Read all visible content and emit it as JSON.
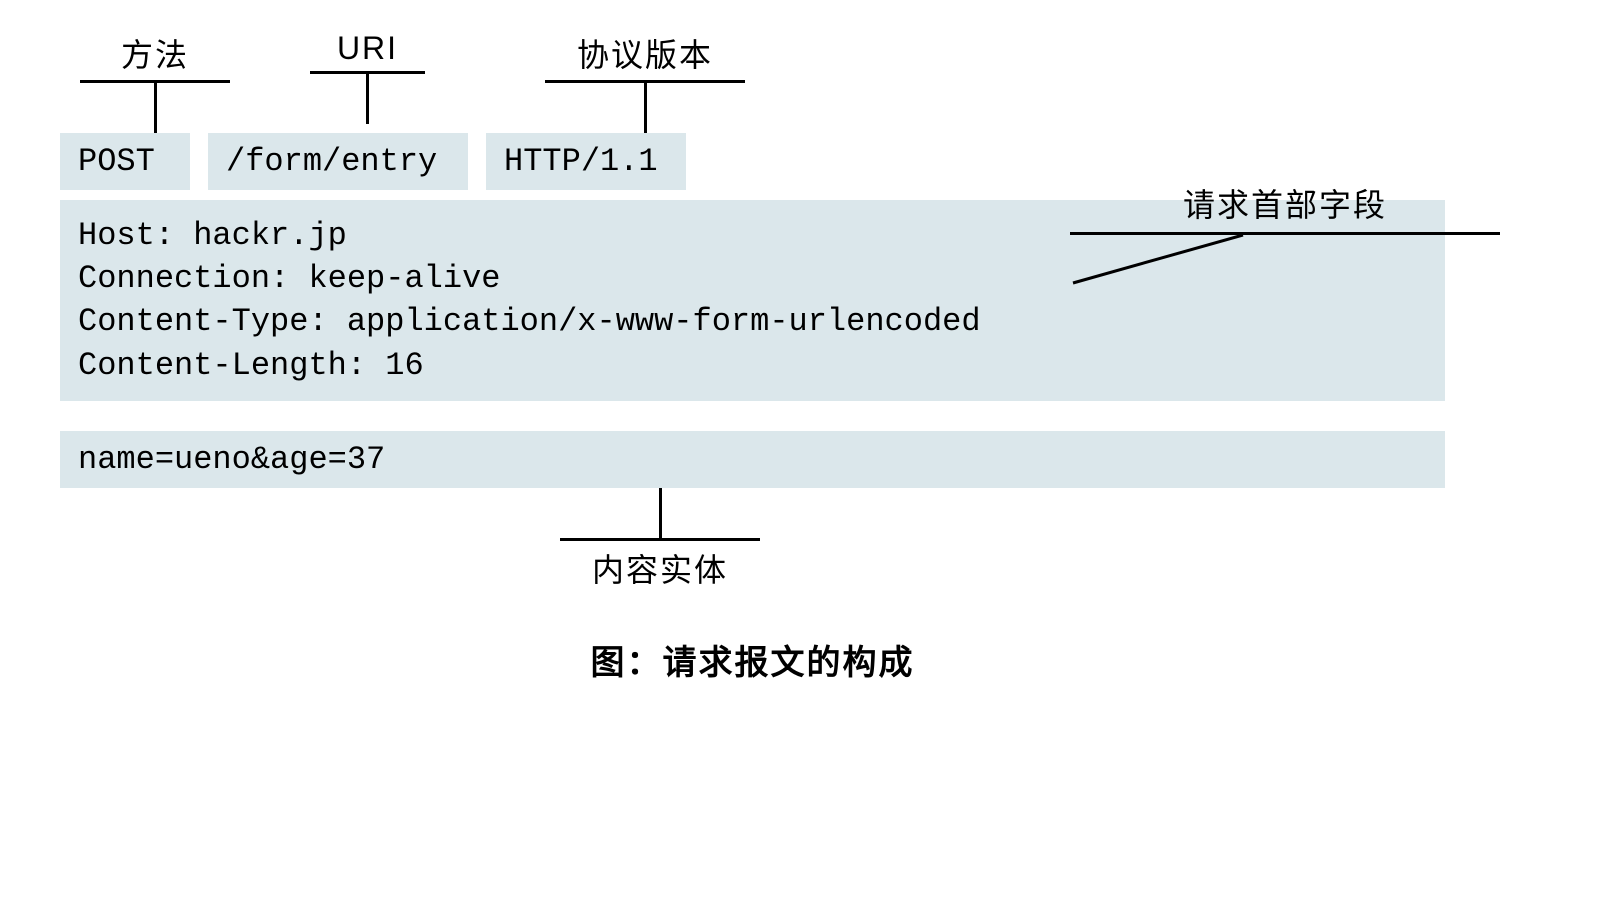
{
  "labels": {
    "method": "方法",
    "uri": "URI",
    "version": "协议版本",
    "header_fields": "请求首部字段",
    "body": "内容实体"
  },
  "request_line": {
    "method": "POST",
    "uri": "/form/entry",
    "version": "HTTP/1.1"
  },
  "headers": {
    "lines": [
      "Host: hackr.jp",
      "Connection: keep-alive",
      "Content-Type: application/x-www-form-urlencoded",
      "Content-Length: 16"
    ]
  },
  "body": "name=ueno&age=37",
  "caption": "图：请求报文的构成"
}
